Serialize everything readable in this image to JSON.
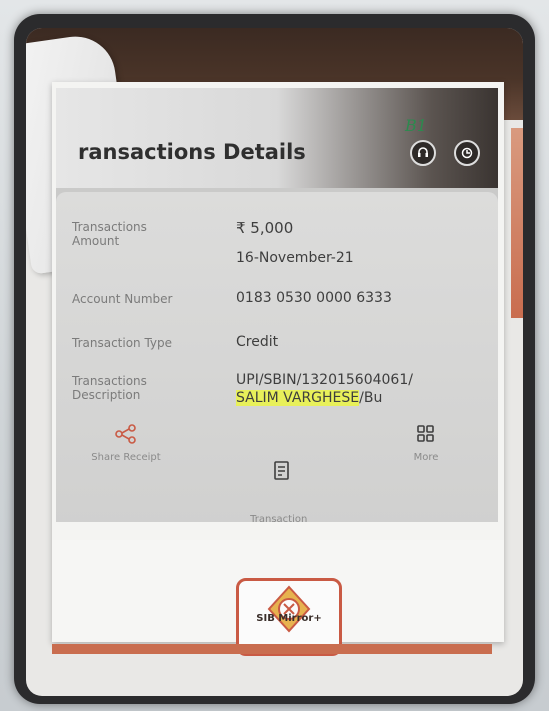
{
  "screen": {
    "title": "ransactions Details",
    "handwritten_note": "B1"
  },
  "details": [
    {
      "label": "Transactions\nAmount",
      "value": "₹ 5,000"
    },
    {
      "label": "",
      "value": "16-November-21"
    },
    {
      "label": "Account Number",
      "value": "0183 0530 0000 6333"
    },
    {
      "label": "Transaction Type",
      "value": "Credit"
    },
    {
      "label": "Transactions\nDescription",
      "value_line1": "UPI/SBIN/132015604061/",
      "value_highlight": "SALIM  VARGHESE",
      "value_rest": "/Bu"
    }
  ],
  "actions": [
    {
      "label": "Share Receipt",
      "icon": "share-icon"
    },
    {
      "label": "Transaction\nHistory",
      "icon": "history-icon"
    },
    {
      "label": "More",
      "icon": "grid-icon"
    }
  ],
  "app": {
    "name": "SIB Mirror+",
    "brand_color": "#c95a44",
    "highlight_color": "#e8f05a",
    "handwriting_color": "#2c8a4e"
  }
}
